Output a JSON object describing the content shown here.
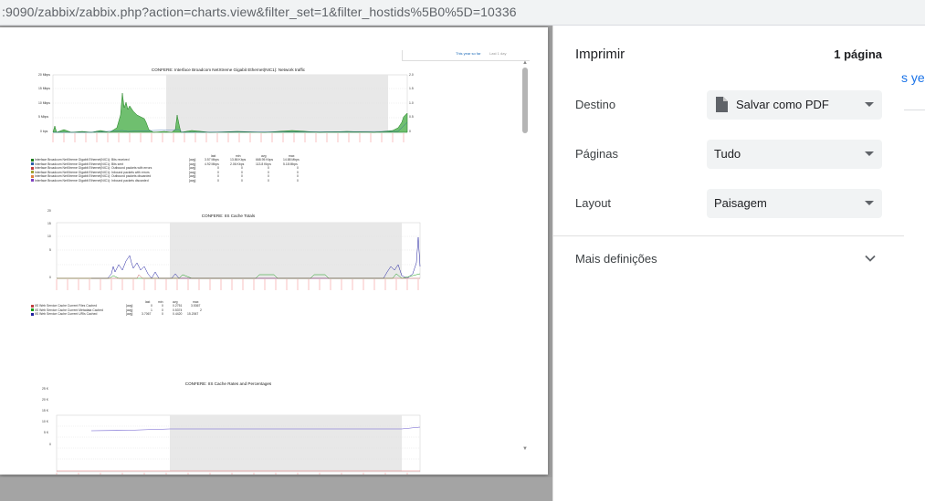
{
  "browser": {
    "url": ":9090/zabbix/zabbix.php?action=charts.view&filter_set=1&filter_hostids%5B0%5D=10336"
  },
  "preview": {
    "nav_left": "This year so far",
    "nav_right": "Last 1 day",
    "charts": [
      {
        "title": "CONFERE: Interface Broadcom NetXtreme Gigabit Ethernet(NIC1): Network traffic",
        "y_ticks": [
          "20 Mbps",
          "15 Mbps",
          "10 Mbps",
          "5 Mbps",
          "0 bps"
        ],
        "y2_ticks": [
          "2.0",
          "1.5",
          "1.0",
          "0.5",
          "0"
        ],
        "legend_headers": [
          "last",
          "min",
          "avg",
          "max"
        ],
        "legend": [
          {
            "name": "Interface Broadcom NetXtreme Gigabit Ethernet(NIC1): Bits received",
            "func": "[avg]",
            "last": "3.57 Mbps",
            "min": "13.86 Kbps",
            "avg": "668.95 Kbps",
            "max": "14.88 Mbps",
            "color": "#1a7c1a"
          },
          {
            "name": "Interface Broadcom NetXtreme Gigabit Ethernet(NIC1): Bits sent",
            "func": "[avg]",
            "last": "4.92 Mbps",
            "min": "2.06 Kbps",
            "avg": "113.8 Kbps",
            "max": "5.18 Mbps",
            "color": "#2b5fa8"
          },
          {
            "name": "Interface Broadcom NetXtreme Gigabit Ethernet(NIC1): Outbound packets with errors",
            "func": "[avg]",
            "last": "0",
            "min": "0",
            "avg": "0",
            "max": "0",
            "color": "#c04040"
          },
          {
            "name": "Interface Broadcom NetXtreme Gigabit Ethernet(NIC1): Inbound packets with errors",
            "func": "[avg]",
            "last": "0",
            "min": "0",
            "avg": "0",
            "max": "0",
            "color": "#a0a030"
          },
          {
            "name": "Interface Broadcom NetXtreme Gigabit Ethernet(NIC1): Outbound packets discarded",
            "func": "[avg]",
            "last": "0",
            "min": "0",
            "avg": "0",
            "max": "0",
            "color": "#e08040"
          },
          {
            "name": "Interface Broadcom NetXtreme Gigabit Ethernet(NIC1): Inbound packets discarded",
            "func": "[avg]",
            "last": "0",
            "min": "0",
            "avg": "0",
            "max": "0",
            "color": "#8040c0"
          }
        ]
      },
      {
        "title": "CONFERE: IIS Cache Totals",
        "y_ticks": [
          "20",
          "15",
          "10",
          "5",
          "0"
        ],
        "legend_headers": [
          "last",
          "min",
          "avg",
          "max"
        ],
        "legend": [
          {
            "name": "IIS Web Service Cache Current Files Cached",
            "func": "[avg]",
            "last": "0",
            "min": "0",
            "avg": "0.2751",
            "max": "3.5367",
            "color": "#c04040"
          },
          {
            "name": "IIS Web Service Cache Current Metadata Cached",
            "func": "[avg]",
            "last": "1",
            "min": "0",
            "avg": "0.5374",
            "max": "2",
            "color": "#1a9c1a"
          },
          {
            "name": "IIS Web Service Cache Current URIs Cached",
            "func": "[avg]",
            "last": "3.7067",
            "min": "0",
            "avg": "0.4420",
            "max": "15.2067",
            "color": "#2020a0"
          }
        ]
      },
      {
        "title": "CONFERE: IIS Cache Rates and Percentages",
        "y_ticks": [
          "25 K",
          "20 K",
          "15 K",
          "10 K",
          "5 K",
          "0"
        ]
      }
    ]
  },
  "print_panel": {
    "title": "Imprimir",
    "page_count": "1 página",
    "destination_label": "Destino",
    "destination_value": "Salvar como PDF",
    "pages_label": "Páginas",
    "pages_value": "Tudo",
    "layout_label": "Layout",
    "layout_value": "Paisagem",
    "more_settings": "Mais definições"
  },
  "background_page": {
    "peek_text": "s yea"
  },
  "colors": {
    "panel_accent": "#1a73e8",
    "select_bg": "#f1f3f4"
  }
}
